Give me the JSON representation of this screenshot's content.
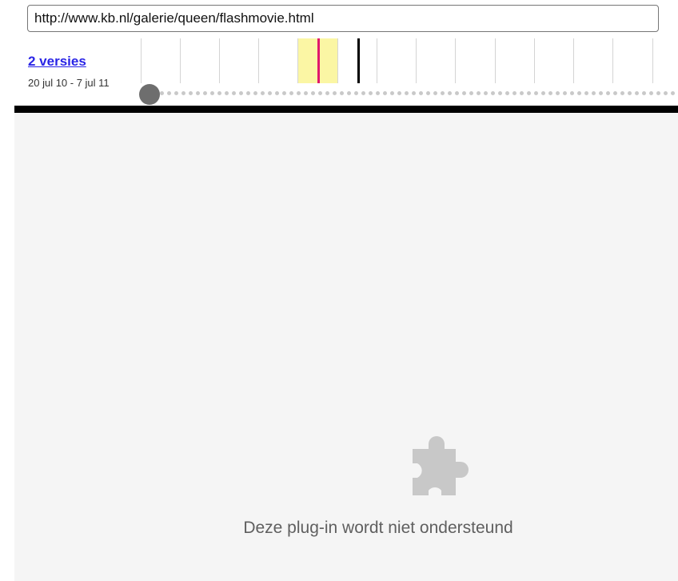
{
  "toolbar": {
    "url": "http://www.kb.nl/galerie/queen/flashmovie.html",
    "versions_label": "2 versies",
    "date_range": "20 jul 10 - 7 jul 11"
  },
  "timeline": {
    "tick_count": 14,
    "highlighted_year_index": 4,
    "captures": [
      {
        "color": "#e0186c"
      },
      {
        "color": "#000000"
      }
    ]
  },
  "colors": {
    "link": "#2a25e6",
    "highlight": "#fbf6a4",
    "capture_primary": "#e0186c",
    "capture_secondary": "#000000",
    "plugin_background": "#f5f5f5",
    "plugin_icon": "#c8c8c8"
  },
  "plugin": {
    "icon": "puzzle-piece-icon",
    "message": "Deze plug-in wordt niet ondersteund"
  }
}
